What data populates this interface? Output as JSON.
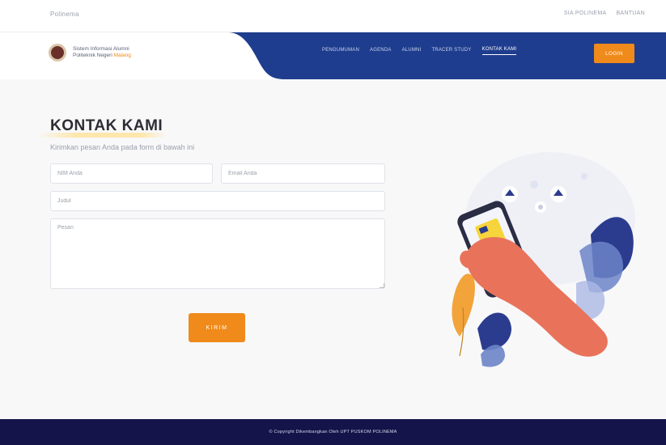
{
  "topbar": {
    "left_text": "Polinema",
    "links": [
      "SIA POLINEMA",
      "BANTUAN"
    ]
  },
  "brand": {
    "line1": "Sistem Informasi Alumni",
    "line2_prefix": "Politeknik Negeri ",
    "line2_accent": "Malang"
  },
  "nav": {
    "items": [
      "PENGUMUMAN",
      "AGENDA",
      "ALUMNI",
      "TRACER STUDY",
      "KONTAK KAMI"
    ],
    "active_index": 4,
    "login_label": "LOGIN"
  },
  "main": {
    "title": "KONTAK KAMI",
    "subtitle": "Kirimkan pesan Anda pada form di bawah ini",
    "form": {
      "name_placeholder": "NIM Anda",
      "email_placeholder": "Email Anda",
      "subject_placeholder": "Judul",
      "message_placeholder": "Pesan",
      "submit_label": "KIRIM"
    }
  },
  "footer": {
    "text": "© Copyright Dikembangkan Oleh UPT PUSKOM POLINEMA"
  },
  "colors": {
    "navy": "#1f3d8e",
    "orange": "#f08a1a",
    "footer": "#14144a"
  }
}
